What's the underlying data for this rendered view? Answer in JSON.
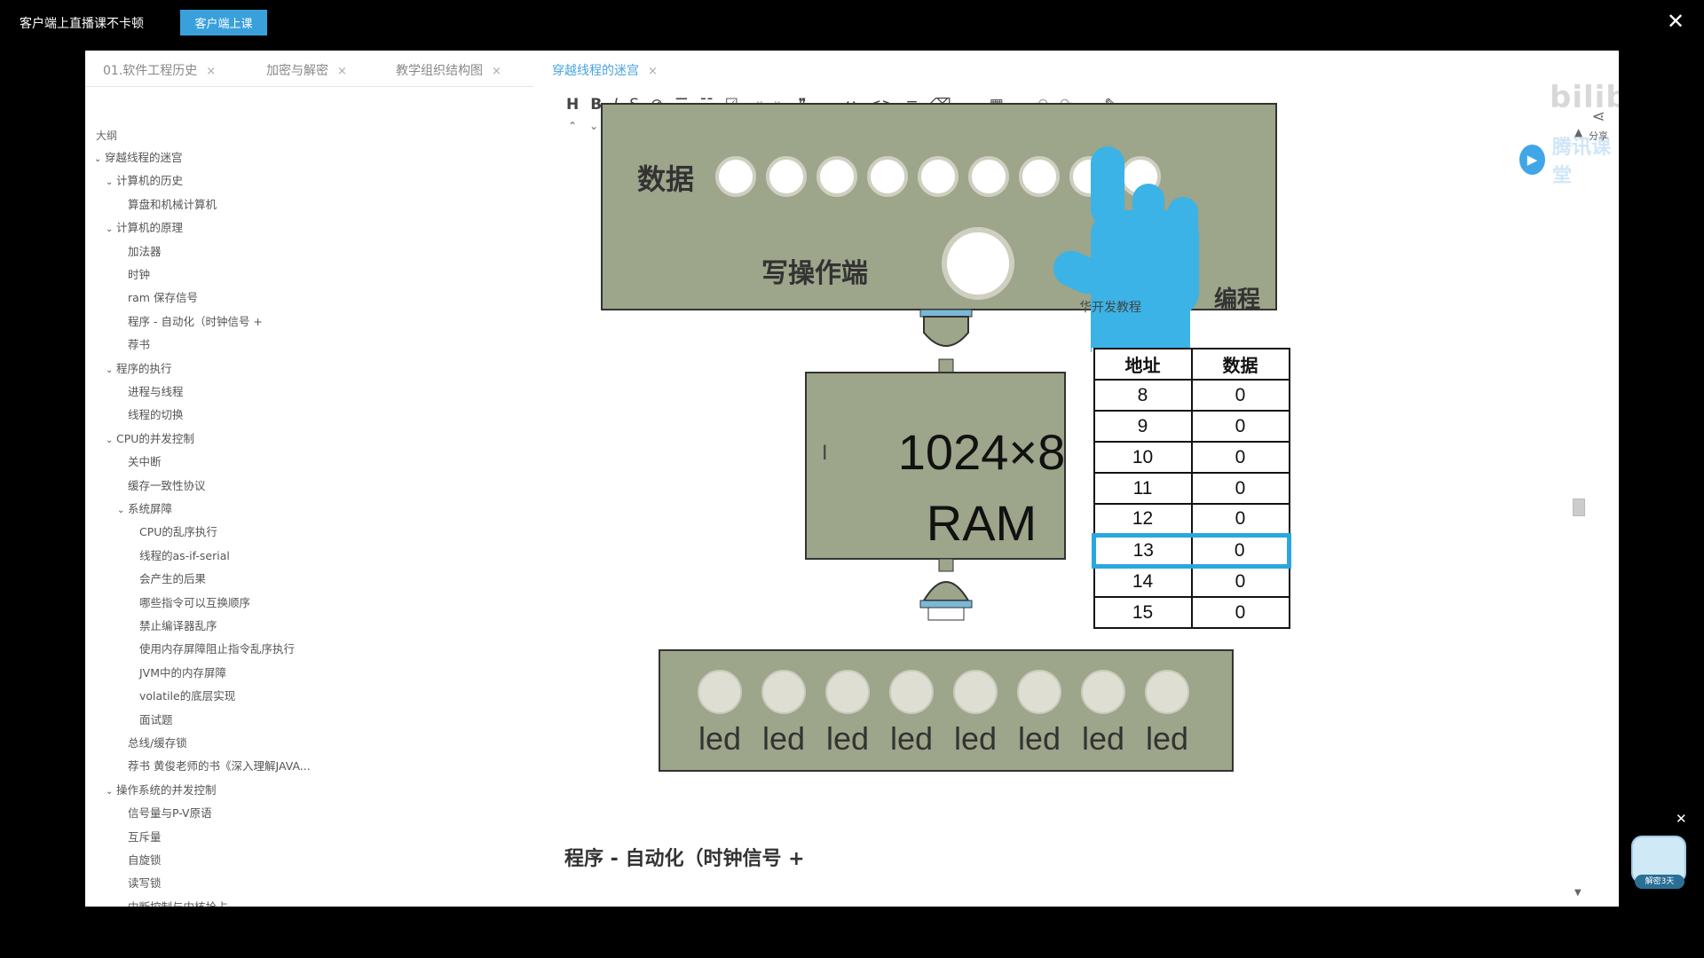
{
  "topbar": {
    "notice": "客户端上直播课不卡顿",
    "client_button": "客户端上课",
    "close": "✕"
  },
  "tabs": [
    {
      "label": "01.软件工程历史",
      "active": false
    },
    {
      "label": "加密与解密",
      "active": false
    },
    {
      "label": "教学组织结构图",
      "active": false
    },
    {
      "label": "穿越线程的迷宫",
      "active": true
    }
  ],
  "tab_close": "×",
  "outline": {
    "title": "大纲",
    "items": [
      {
        "label": "穿越线程的迷宫",
        "chevron": true
      },
      {
        "label": "计算机的历史",
        "chevron": true
      },
      {
        "label": "算盘和机械计算机",
        "chevron": false
      },
      {
        "label": "计算机的原理",
        "chevron": true
      },
      {
        "label": "加法器",
        "chevron": false
      },
      {
        "label": "时钟",
        "chevron": false
      },
      {
        "label": "ram 保存信号",
        "chevron": false
      },
      {
        "label": "程序 - 自动化（时钟信号 +",
        "chevron": false
      },
      {
        "label": "荐书",
        "chevron": false
      },
      {
        "label": "程序的执行",
        "chevron": true
      },
      {
        "label": "进程与线程",
        "chevron": false
      },
      {
        "label": "线程的切换",
        "chevron": false
      },
      {
        "label": "CPU的并发控制",
        "chevron": true
      },
      {
        "label": "关中断",
        "chevron": false
      },
      {
        "label": "缓存一致性协议",
        "chevron": false
      },
      {
        "label": "系统屏障",
        "chevron": true
      },
      {
        "label": "CPU的乱序执行",
        "chevron": false
      },
      {
        "label": "线程的as-if-serial",
        "chevron": false
      },
      {
        "label": "会产生的后果",
        "chevron": false
      },
      {
        "label": "哪些指令可以互换顺序",
        "chevron": false
      },
      {
        "label": "禁止编译器乱序",
        "chevron": false
      },
      {
        "label": "使用内存屏障阻止指令乱序执行",
        "chevron": false
      },
      {
        "label": "JVM中的内存屏障",
        "chevron": false
      },
      {
        "label": "volatile的底层实现",
        "chevron": false
      },
      {
        "label": "面试题",
        "chevron": false
      },
      {
        "label": "总线/缓存锁",
        "chevron": false
      },
      {
        "label": "荐书 黄俊老师的书《深入理解JAVA...",
        "chevron": false
      },
      {
        "label": "操作系统的并发控制",
        "chevron": true
      },
      {
        "label": "信号量与P-V原语",
        "chevron": false
      },
      {
        "label": "互斥量",
        "chevron": false
      },
      {
        "label": "自旋锁",
        "chevron": false
      },
      {
        "label": "读写锁",
        "chevron": false
      },
      {
        "label": "中断控制与内核抢占",
        "chevron": false
      }
    ]
  },
  "toolbar": {
    "icons": [
      "heading-icon",
      "bold-icon",
      "italic-icon",
      "strikethrough-icon",
      "link-icon",
      "bullet-list-icon",
      "numbered-list-icon",
      "checklist-icon",
      "indent-icon",
      "outdent-icon",
      "quote-icon",
      "divider-icon",
      "code-icon",
      "code-block-icon",
      "align-icon",
      "clear-format-icon",
      "upload-icon",
      "table-icon",
      "undo-icon",
      "redo-icon",
      "pen-icon",
      "more-icon"
    ],
    "glyphs": [
      "H",
      "B",
      "I",
      "S",
      "⊘",
      "☰",
      "☷",
      "☑",
      "⇥",
      "⇤",
      "❞",
      "—",
      "↔",
      "<>",
      "≡",
      "⌫",
      "☁",
      "▦",
      "↶",
      "↷",
      "✎",
      "⋯"
    ],
    "sub_glyphs": [
      "⌃",
      "⌄",
      "🗑"
    ]
  },
  "watermark": {
    "bilibili": "bilibili",
    "tencent": "腾讯课堂"
  },
  "share_label": "分享",
  "diagram": {
    "data_label": "数据",
    "write_label": "写操作端",
    "program_label": "编程",
    "hand_caption": "华开发教程",
    "ram_line1": "1024×8",
    "ram_line2": "RAM",
    "led_label": "led",
    "data_lights_on": [
      false,
      false,
      false,
      false,
      false,
      false,
      false,
      false,
      false
    ],
    "table": {
      "headers": [
        "地址",
        "数据"
      ],
      "rows": [
        {
          "addr": "8",
          "data": "0"
        },
        {
          "addr": "9",
          "data": "0"
        },
        {
          "addr": "10",
          "data": "0"
        },
        {
          "addr": "11",
          "data": "0"
        },
        {
          "addr": "12",
          "data": "0"
        },
        {
          "addr": "13",
          "data": "0"
        },
        {
          "addr": "14",
          "data": "0"
        },
        {
          "addr": "15",
          "data": "0"
        }
      ],
      "highlighted_addr": "13"
    },
    "colors": {
      "panel": "#9da58a",
      "highlight": "#2aa7e0",
      "hand": "#3bb3e6"
    }
  },
  "section_heading": "程序 - 自动化（时钟信号 +",
  "mascot": {
    "tag": "解密3天",
    "close": "✕"
  }
}
